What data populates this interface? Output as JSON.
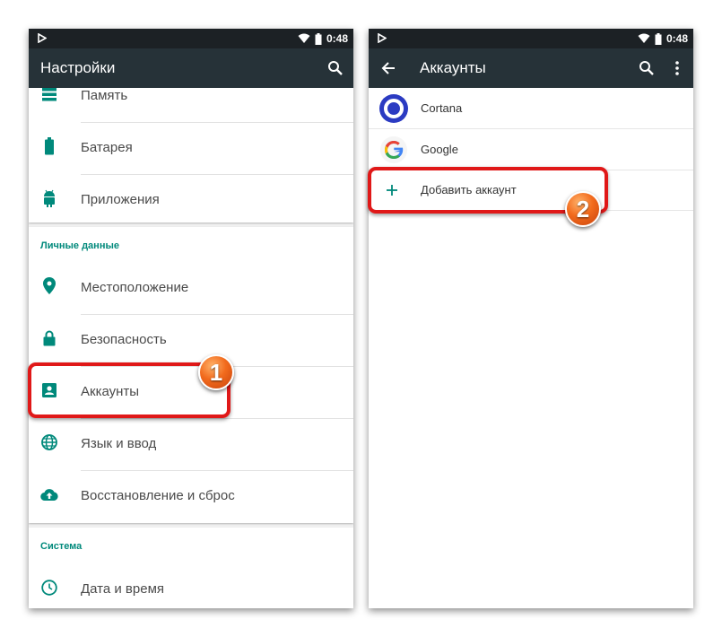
{
  "colors": {
    "statusbar": "#1c2125",
    "appbar": "#263238",
    "accent": "#00897b",
    "highlight": "#e01818",
    "badge": "#f26b1d"
  },
  "status_bar": {
    "time": "0:48",
    "icons": [
      "play-icon",
      "wifi-icon",
      "battery-icon"
    ]
  },
  "settings_screen": {
    "title": "Настройки",
    "top_items": [
      {
        "label": "Память",
        "icon": "storage-icon"
      },
      {
        "label": "Батарея",
        "icon": "battery-icon"
      },
      {
        "label": "Приложения",
        "icon": "android-icon"
      }
    ],
    "personal_section": {
      "title": "Личные данные",
      "items": [
        {
          "label": "Местоположение",
          "icon": "location-icon"
        },
        {
          "label": "Безопасность",
          "icon": "lock-icon"
        },
        {
          "label": "Аккаунты",
          "icon": "account-box-icon"
        },
        {
          "label": "Язык и ввод",
          "icon": "globe-icon"
        },
        {
          "label": "Восстановление и сброс",
          "icon": "cloud-upload-icon"
        }
      ]
    },
    "system_section": {
      "title": "Система",
      "items": [
        {
          "label": "Дата и время",
          "icon": "clock-icon"
        }
      ]
    }
  },
  "accounts_screen": {
    "title": "Аккаунты",
    "accounts": [
      {
        "label": "Cortana",
        "icon": "cortana-icon"
      },
      {
        "label": "Google",
        "icon": "google-icon"
      }
    ],
    "add_account": {
      "label": "Добавить аккаунт",
      "icon": "plus-icon"
    }
  },
  "step_badges": {
    "step1": "1",
    "step2": "2"
  }
}
